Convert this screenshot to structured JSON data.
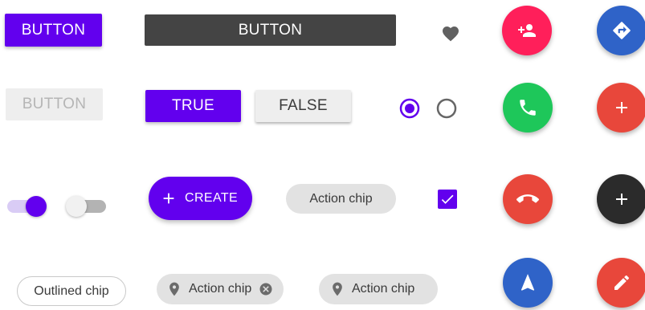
{
  "colors": {
    "primary": "#6200ee",
    "dark_button": "#444444",
    "fab_add_person": "#ff1f5a",
    "fab_directions": "#2f63c8",
    "fab_call": "#1ec75a",
    "fab_add_red": "#e8473b",
    "fab_call_end": "#e8473b",
    "fab_add_dark": "#2b2b2b",
    "fab_navigation": "#2f63c8",
    "fab_edit": "#e8473b"
  },
  "buttons": {
    "primary_label": "BUTTON",
    "dark_label": "BUTTON",
    "disabled_label": "BUTTON"
  },
  "toggle_group": {
    "true_label": "TRUE",
    "false_label": "FALSE"
  },
  "extended_fab": {
    "label": "CREATE",
    "icon": "plus-icon"
  },
  "chips": {
    "action_chip_plain": "Action chip",
    "outlined_chip": "Outlined chip",
    "action_chip_with_close": "Action chip",
    "action_chip_location": "Action chip"
  },
  "controls": {
    "radio_selected": true,
    "radio_unselected": false,
    "checkbox_checked": true,
    "switch_on": true,
    "switch_off": false
  },
  "icons": {
    "favorite": "heart-icon",
    "add_person": "person-add-icon",
    "directions": "directions-icon",
    "call": "phone-icon",
    "add": "plus-icon",
    "call_end": "call-end-icon",
    "navigation": "navigation-icon",
    "edit": "pencil-icon",
    "location": "location-pin-icon",
    "cancel": "close-circle-icon"
  }
}
